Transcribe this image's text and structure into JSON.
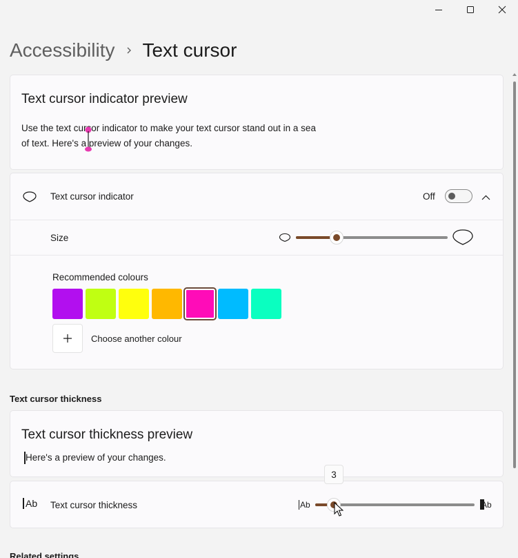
{
  "breadcrumb": {
    "parent": "Accessibility",
    "current": "Text cursor"
  },
  "preview_card": {
    "title": "Text cursor indicator preview",
    "line1": "Use the text cursor indicator to make your text cursor stand out in a sea",
    "line2": "of text. Here's a preview of your changes.",
    "indicator_color": "#e83ab0"
  },
  "indicator_setting": {
    "label": "Text cursor indicator",
    "toggle_state": "Off"
  },
  "size_setting": {
    "label": "Size",
    "value_fraction": 0.22
  },
  "colours": {
    "heading": "Recommended colours",
    "swatches": [
      "#b20fef",
      "#c0ff12",
      "#ffff0d",
      "#ffb800",
      "#ff0cb8",
      "#00bbff",
      "#0affc0"
    ],
    "selected_index": 4,
    "another_label": "Choose another colour"
  },
  "thickness_section": {
    "label": "Text cursor thickness"
  },
  "thickness_preview": {
    "title": "Text cursor thickness preview",
    "text": "Here's a preview of your changes."
  },
  "thickness_setting": {
    "label": "Text cursor thickness",
    "value": "3",
    "value_fraction": 0.08,
    "icon_small": "Ab",
    "icon_large": "Ab"
  },
  "related": {
    "label": "Related settings"
  },
  "accent_color": "#7a4a2a"
}
